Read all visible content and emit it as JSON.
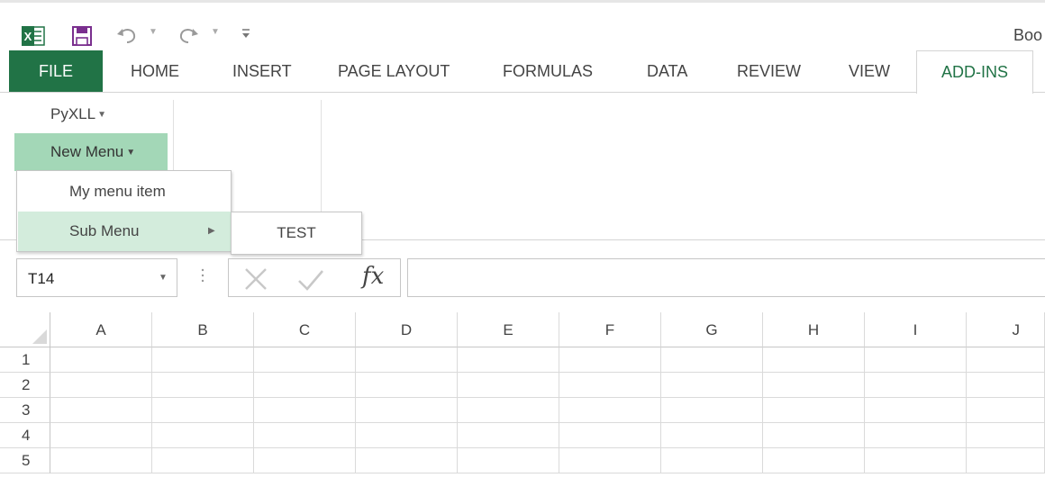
{
  "window": {
    "title": "Boo"
  },
  "tabs": [
    {
      "label": "FILE"
    },
    {
      "label": "HOME"
    },
    {
      "label": "INSERT"
    },
    {
      "label": "PAGE LAYOUT"
    },
    {
      "label": "FORMULAS"
    },
    {
      "label": "DATA"
    },
    {
      "label": "REVIEW"
    },
    {
      "label": "VIEW"
    },
    {
      "label": "ADD-INS"
    }
  ],
  "active_tab": "ADD-INS",
  "ribbon": {
    "pyxll_label": "PyXLL",
    "new_menu_label": "New Menu"
  },
  "menu": {
    "items": [
      {
        "label": "My menu item"
      },
      {
        "label": "Sub Menu"
      }
    ],
    "submenu": {
      "items": [
        {
          "label": "TEST"
        }
      ]
    }
  },
  "formula_bar": {
    "name_box": "T14",
    "fx_label": "fx",
    "formula_value": ""
  },
  "grid": {
    "columns": [
      "A",
      "B",
      "C",
      "D",
      "E",
      "F",
      "G",
      "H",
      "I",
      "J"
    ],
    "rows": [
      "1",
      "2",
      "3",
      "4",
      "5"
    ]
  },
  "colors": {
    "excel_green": "#217346",
    "hover_green": "#a3d7b7",
    "menu_highlight": "#d3ecdc"
  },
  "icons": {
    "app": "excel-logo-icon",
    "save": "save-icon",
    "undo": "undo-icon",
    "redo": "redo-icon",
    "customize": "customize-qat-icon",
    "cancel": "cancel-x-icon",
    "enter": "enter-checkmark-icon"
  }
}
